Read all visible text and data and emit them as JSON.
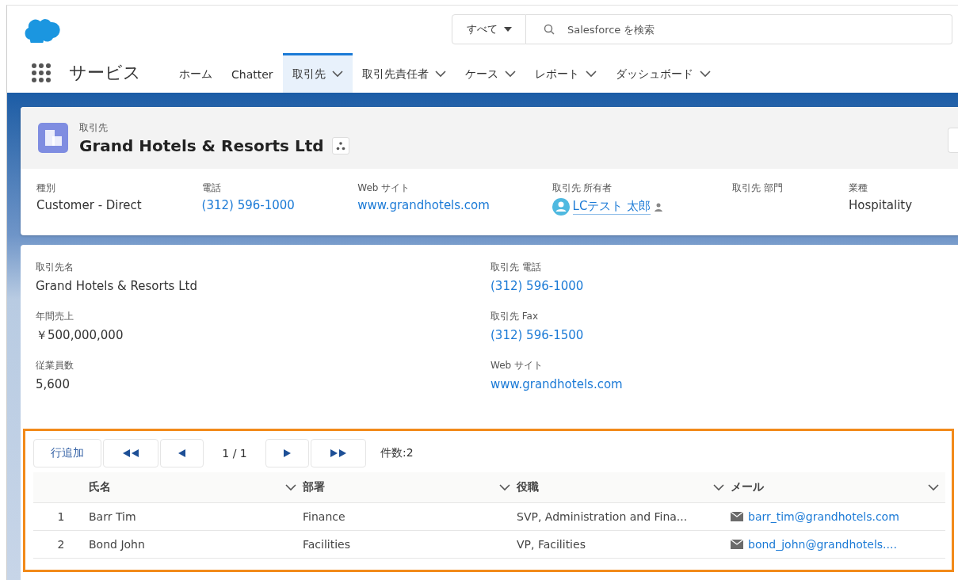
{
  "header": {
    "search_scope": "すべて",
    "search_placeholder": "Salesforce を検索"
  },
  "nav": {
    "app_name": "サービス",
    "tabs": [
      {
        "label": "ホーム",
        "selected": false,
        "has_menu": false
      },
      {
        "label": "Chatter",
        "selected": false,
        "has_menu": false
      },
      {
        "label": "取引先",
        "selected": true,
        "has_menu": true
      },
      {
        "label": "取引先責任者",
        "selected": false,
        "has_menu": true
      },
      {
        "label": "ケース",
        "selected": false,
        "has_menu": true
      },
      {
        "label": "レポート",
        "selected": false,
        "has_menu": true
      },
      {
        "label": "ダッシュボード",
        "selected": false,
        "has_menu": true
      }
    ]
  },
  "record": {
    "object_type": "取引先",
    "name": "Grand Hotels & Resorts Ltd",
    "highlights": [
      {
        "label": "種別",
        "value": "Customer - Direct",
        "kind": "text"
      },
      {
        "label": "電話",
        "value": "(312) 596-1000",
        "kind": "link"
      },
      {
        "label": "Web サイト",
        "value": "www.grandhotels.com",
        "kind": "link"
      },
      {
        "label": "取引先 所有者",
        "value": "LCテスト 太郎",
        "kind": "user"
      },
      {
        "label": "取引先 部門",
        "kind": "text"
      },
      {
        "label": "業種",
        "value": "Hospitality",
        "kind": "text"
      }
    ]
  },
  "details": {
    "left": [
      {
        "label": "取引先名",
        "value": "Grand Hotels & Resorts Ltd",
        "kind": "text"
      },
      {
        "label": "年間売上",
        "value": "￥500,000,000",
        "kind": "text"
      },
      {
        "label": "従業員数",
        "value": "5,600",
        "kind": "text"
      }
    ],
    "right": [
      {
        "label": "取引先 電話",
        "value": "(312) 596-1000",
        "kind": "link"
      },
      {
        "label": "取引先 Fax",
        "value": "(312) 596-1500",
        "kind": "link"
      },
      {
        "label": "Web サイト",
        "value": "www.grandhotels.com",
        "kind": "link"
      }
    ]
  },
  "contacts_table": {
    "add_button": "行追加",
    "page": "1 / 1",
    "count": "件数:2",
    "columns": [
      {
        "label": "氏名"
      },
      {
        "label": "部署"
      },
      {
        "label": "役職"
      },
      {
        "label": "メール"
      }
    ],
    "rows": [
      {
        "number": "1",
        "name": "Barr Tim",
        "department": "Finance",
        "title": "SVP, Administration and Fina...",
        "email": "barr_tim@grandhotels.com"
      },
      {
        "number": "2",
        "name": "Bond John",
        "department": "Facilities",
        "title": "VP, Facilities",
        "email": "bond_john@grandhotels...."
      }
    ]
  }
}
